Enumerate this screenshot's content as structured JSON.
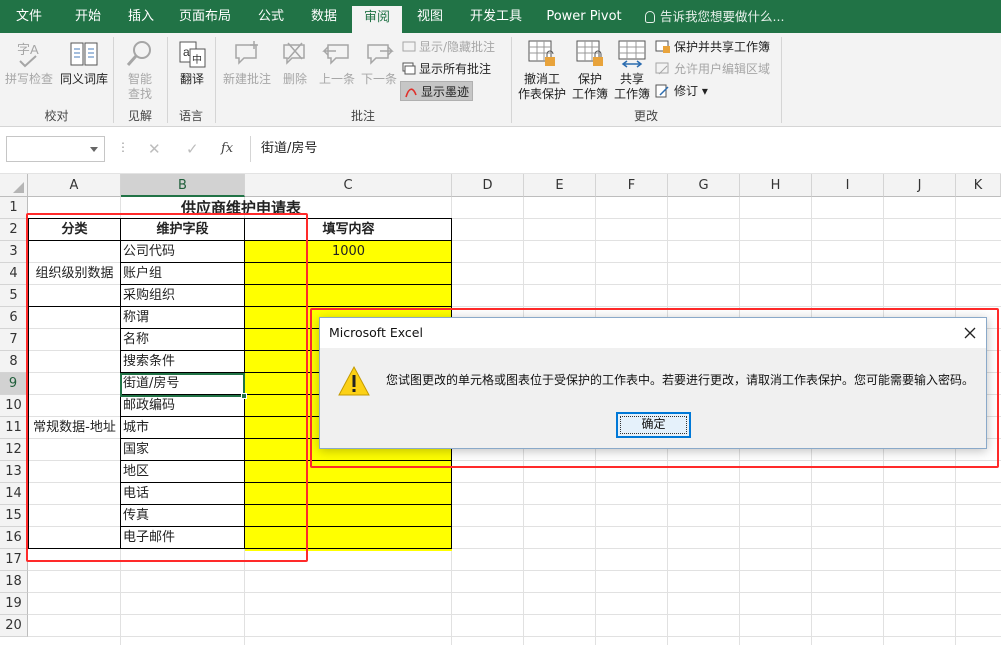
{
  "ribbon_tabs": [
    "文件",
    "开始",
    "插入",
    "页面布局",
    "公式",
    "数据",
    "审阅",
    "视图",
    "开发工具",
    "Power Pivot"
  ],
  "active_tab": "审阅",
  "tell_me": "告诉我您想要做什么...",
  "groups": {
    "proofing": {
      "label": "校对",
      "spelling": "拼写检查",
      "thesaurus": "同义词库"
    },
    "insights": {
      "label": "见解",
      "smart_lookup_1": "智能",
      "smart_lookup_2": "查找"
    },
    "language": {
      "label": "语言",
      "translate": "翻译"
    },
    "comments": {
      "label": "批注",
      "new_comment": "新建批注",
      "delete": "删除",
      "previous": "上一条",
      "next": "下一条",
      "show_hide": "显示/隐藏批注",
      "show_all": "显示所有批注",
      "show_ink": "显示墨迹"
    },
    "changes": {
      "label": "更改",
      "unprotect_sheet_1": "撤消工",
      "unprotect_sheet_2": "作表保护",
      "protect_wb_1": "保护",
      "protect_wb_2": "工作簿",
      "share_wb_1": "共享",
      "share_wb_2": "工作簿",
      "protect_share": "保护并共享工作簿",
      "allow_edit": "允许用户编辑区域",
      "track_changes": "修订"
    }
  },
  "formula_bar": {
    "name_box": "",
    "fx": "fx",
    "content": "街道/房号"
  },
  "columns": [
    "A",
    "B",
    "C",
    "D",
    "E",
    "F",
    "G",
    "H",
    "I",
    "J",
    "K"
  ],
  "selected_column": "B",
  "rows": [
    "1",
    "2",
    "3",
    "4",
    "5",
    "6",
    "7",
    "8",
    "9",
    "10",
    "11",
    "12",
    "13",
    "14",
    "15",
    "16",
    "17",
    "18",
    "19",
    "20"
  ],
  "selected_row": "9",
  "sheet": {
    "title": "供应商维护申请表",
    "headers": {
      "category": "分类",
      "field": "维护字段",
      "content": "填写内容"
    },
    "group_org": "组织级别数据",
    "group_general": "常规数据-地址",
    "fields": [
      "公司代码",
      "账户组",
      "采购组织",
      "称谓",
      "名称",
      "搜索条件",
      "街道/房号",
      "邮政编码",
      "城市",
      "国家",
      "地区",
      "电话",
      "传真",
      "电子邮件"
    ],
    "company_code_value": "1000"
  },
  "dialog": {
    "title": "Microsoft Excel",
    "message": "您试图更改的单元格或图表位于受保护的工作表中。若要进行更改，请取消工作表保护。您可能需要输入密码。",
    "ok": "确定"
  }
}
